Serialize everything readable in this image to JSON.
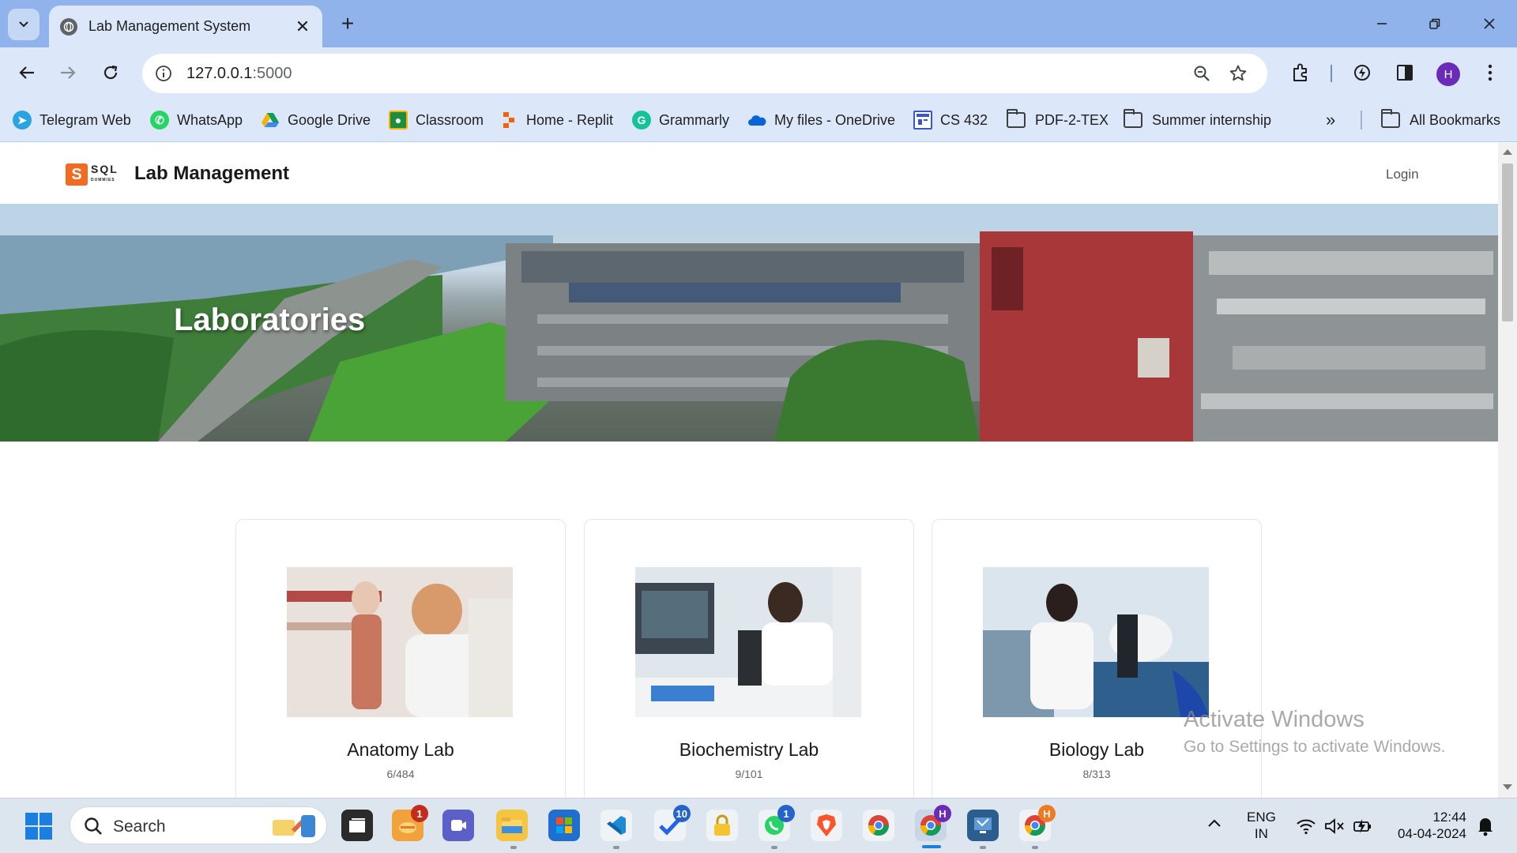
{
  "browser": {
    "tab_title": "Lab Management System",
    "url_host": "127.0.0.1",
    "url_port": ":5000",
    "profile_initial": "H"
  },
  "bookmarks": [
    {
      "label": "Telegram Web",
      "icon": "telegram-icon",
      "color": "#2aa3e0"
    },
    {
      "label": "WhatsApp",
      "icon": "whatsapp-icon",
      "color": "#25d366"
    },
    {
      "label": "Google Drive",
      "icon": "google-drive-icon",
      "color": "#f4b400"
    },
    {
      "label": "Classroom",
      "icon": "classroom-icon",
      "color": "#f4b400"
    },
    {
      "label": "Home - Replit",
      "icon": "replit-icon",
      "color": "#f26207"
    },
    {
      "label": "Grammarly",
      "icon": "grammarly-icon",
      "color": "#15c39a"
    },
    {
      "label": "My files - OneDrive",
      "icon": "onedrive-icon",
      "color": "#0a64d6"
    },
    {
      "label": "CS 432",
      "icon": "page-icon",
      "color": "#3a56c4"
    },
    {
      "label": "PDF-2-TEX",
      "icon": "folder-icon",
      "color": "#3c4043"
    },
    {
      "label": "Summer internship",
      "icon": "folder-icon",
      "color": "#3c4043"
    }
  ],
  "all_bookmarks_label": "All Bookmarks",
  "site": {
    "brand": "Lab Management",
    "login": "Login",
    "logo_letter": "S",
    "logo_text": "SQL",
    "logo_sub": "DUMMIES",
    "hero_title": "Laboratories"
  },
  "labs": [
    {
      "name": "Anatomy Lab",
      "count": "6/484"
    },
    {
      "name": "Biochemistry Lab",
      "count": "9/101"
    },
    {
      "name": "Biology Lab",
      "count": "8/313"
    }
  ],
  "watermark": {
    "line1": "Activate Windows",
    "line2": "Go to Settings to activate Windows."
  },
  "taskbar": {
    "search_placeholder": "Search",
    "lang_line1": "ENG",
    "lang_line2": "IN",
    "time": "12:44",
    "date": "04-04-2024",
    "badges": {
      "weather": "1",
      "todo": "10",
      "whatsapp": "1",
      "chrome_profile_h": "H",
      "chrome_profile_h2": "H"
    }
  }
}
